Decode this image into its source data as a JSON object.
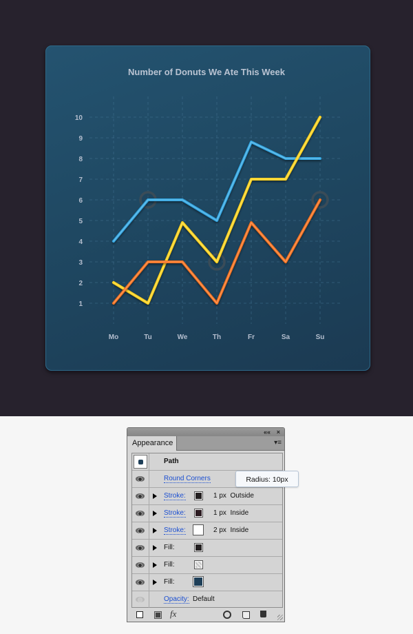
{
  "chart_card": {
    "title": "Number of Donuts We Ate This Week"
  },
  "chart_data": {
    "type": "line",
    "title": "Number of Donuts We Ate This Week",
    "xlabel": "",
    "ylabel": "",
    "categories": [
      "Mo",
      "Tu",
      "We",
      "Th",
      "Fr",
      "Sa",
      "Su"
    ],
    "y_ticks": [
      "1",
      "2",
      "3",
      "4",
      "5",
      "6",
      "7",
      "8",
      "9",
      "10"
    ],
    "ylim": [
      1,
      10
    ],
    "grid": true,
    "series": [
      {
        "name": "blue",
        "color": "#33a6e2",
        "values": [
          4,
          6,
          6,
          5,
          8.8,
          8,
          8
        ]
      },
      {
        "name": "yellow",
        "color": "#ffd21a",
        "values": [
          2,
          1,
          4.9,
          3,
          7,
          7,
          10
        ]
      },
      {
        "name": "orange",
        "color": "#f5701f",
        "values": [
          1,
          3,
          3,
          1,
          4.9,
          3,
          6
        ]
      }
    ],
    "highlight_markers": [
      {
        "category": "Tu",
        "value": 6
      },
      {
        "category": "Th",
        "value": 3
      },
      {
        "category": "Su",
        "value": 6
      }
    ]
  },
  "appearance_panel": {
    "collapse_icon": "««",
    "close_icon": "×",
    "tab_label": "Appearance",
    "menu_icon": "▾≡",
    "object_label": "Path",
    "rows": [
      {
        "type": "effect",
        "label": "Round Corners"
      },
      {
        "type": "stroke",
        "label": "Stroke:",
        "color": "#231f20",
        "weight": "1 px",
        "align": "Outside"
      },
      {
        "type": "stroke",
        "label": "Stroke:",
        "color": "#2c1b21",
        "weight": "1 px",
        "align": "Inside"
      },
      {
        "type": "stroke",
        "label": "Stroke:",
        "color": "#ffffff",
        "weight": "2 px",
        "align": "Inside"
      },
      {
        "type": "fill",
        "label": "Fill:",
        "color": "#231f20"
      },
      {
        "type": "fill",
        "label": "Fill:",
        "color": "pattern"
      },
      {
        "type": "fill",
        "label": "Fill:",
        "color": "#1e3f58"
      },
      {
        "type": "opacity",
        "label": "Opacity:",
        "value": "Default"
      }
    ],
    "tooltip": "Radius: 10px",
    "footer": {
      "add_stroke": "add-stroke",
      "add_fill": "add-fill",
      "fx": "fx",
      "clear": "clear-appearance",
      "duplicate": "duplicate-item",
      "delete": "delete-item"
    }
  }
}
